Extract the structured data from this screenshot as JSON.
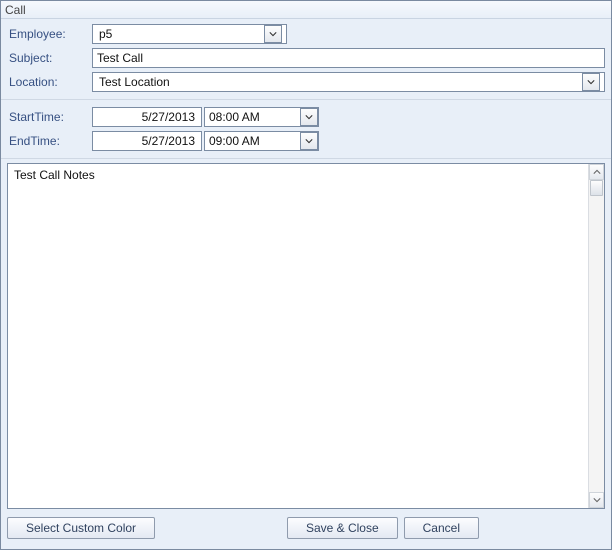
{
  "window": {
    "title": "Call"
  },
  "labels": {
    "employee": "Employee:",
    "subject": "Subject:",
    "location": "Location:",
    "startTime": "StartTime:",
    "endTime": "EndTime:"
  },
  "fields": {
    "employee": "p5",
    "subject": "Test Call",
    "location": "Test Location",
    "startDate": "5/27/2013",
    "startTime": "08:00 AM",
    "endDate": "5/27/2013",
    "endTime": "09:00 AM",
    "notes": "Test Call Notes"
  },
  "buttons": {
    "selectColor": "Select Custom Color",
    "saveClose": "Save & Close",
    "cancel": "Cancel"
  },
  "icons": {
    "dropdown": "chevron-down-icon",
    "scrollUp": "scroll-up-icon",
    "scrollDown": "scroll-down-icon"
  }
}
